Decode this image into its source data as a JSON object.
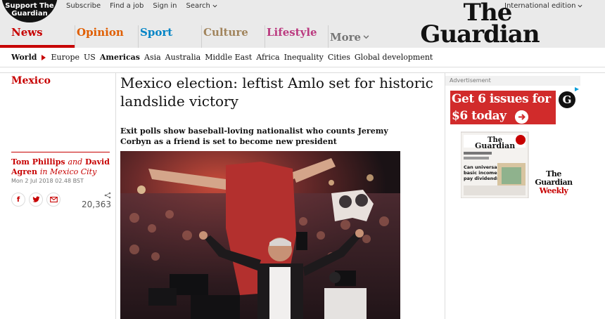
{
  "header": {
    "support": "Support The Guardian",
    "top_links": {
      "subscribe": "Subscribe",
      "find_job": "Find a job",
      "sign_in": "Sign in",
      "search": "Search"
    },
    "edition": "International edition",
    "logo_line1": "The",
    "logo_line2": "Guardian"
  },
  "pillars": [
    {
      "label": "News",
      "color": "#c70000"
    },
    {
      "label": "Opinion",
      "color": "#e05e00"
    },
    {
      "label": "Sport",
      "color": "#0084c6"
    },
    {
      "label": "Culture",
      "color": "#a1845c"
    },
    {
      "label": "Lifestyle",
      "color": "#bb3b80"
    },
    {
      "label": "More",
      "color": "#767676"
    }
  ],
  "subnav": {
    "world": "World",
    "items": [
      "Europe",
      "US",
      "Americas",
      "Asia",
      "Australia",
      "Middle East",
      "Africa",
      "Inequality",
      "Cities",
      "Global development"
    ]
  },
  "article": {
    "section": "Mexico",
    "headline": "Mexico election: leftist Amlo set for historic landslide victory",
    "standfirst": "Exit polls show baseball-loving nationalist who counts Jeremy Corbyn as a friend is set to become new president",
    "author1": "Tom Phillips",
    "and_word": "and",
    "author2": "David Agren",
    "location": "in Mexico City",
    "date": "Mon 2 Jul 2018 02.48 BST",
    "share_count": "20,363",
    "share_buttons": {
      "facebook": "f",
      "twitter": "t",
      "email": "e"
    }
  },
  "ad": {
    "label": "Advertisement",
    "headline_line1": "Get 6 issues for",
    "headline_line2": "$6 today",
    "magazine_line1": "The",
    "magazine_line2": "Guardian",
    "magazine_line3": "Weekly",
    "badge": "G"
  },
  "colors": {
    "brand_red": "#c70000",
    "header_bg": "#eaeaea"
  }
}
